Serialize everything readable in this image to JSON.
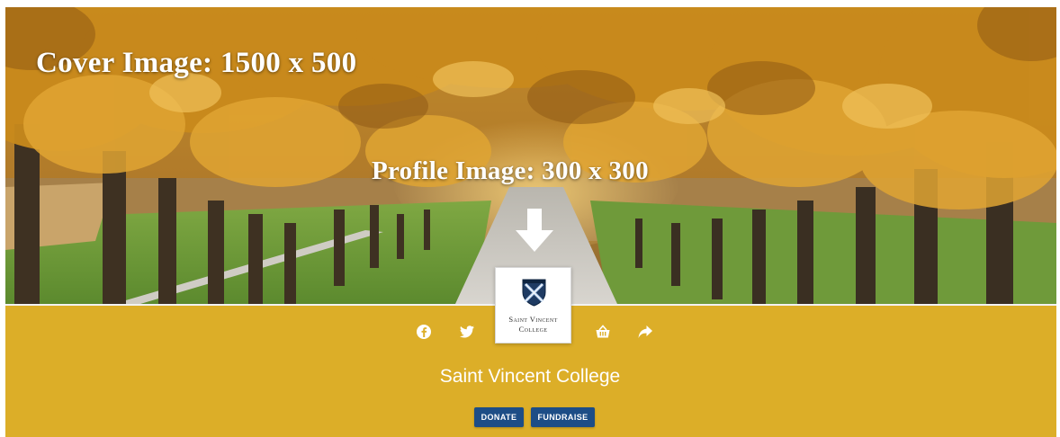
{
  "cover": {
    "caption": "Cover Image: 1500 x 500",
    "profile_caption": "Profile Image: 300 x 300"
  },
  "profile": {
    "logo_name_line1": "Saint Vincent",
    "logo_name_line2": "College"
  },
  "organization": {
    "name": "Saint Vincent College"
  },
  "social_icons": [
    "facebook-icon",
    "twitter-icon",
    "basket-icon",
    "share-icon"
  ],
  "actions": {
    "donate_label": "DONATE",
    "fundraise_label": "FUNDRAISE"
  },
  "colors": {
    "band": "#dcae28",
    "button": "#1d4d86",
    "foliage": "#c98a1c",
    "grass": "#6f9a3a"
  }
}
